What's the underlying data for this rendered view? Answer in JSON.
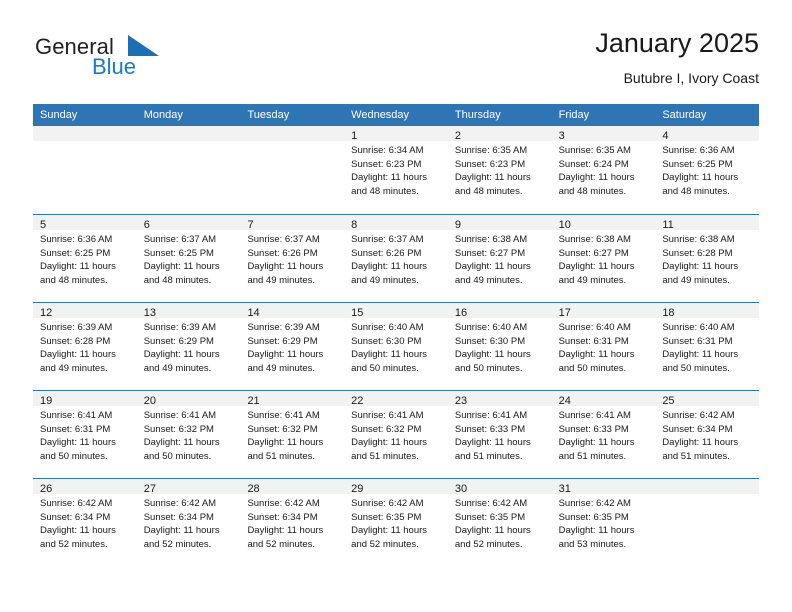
{
  "brand": {
    "name_part1": "General",
    "name_part2": "Blue",
    "logo_icon": "triangle-icon",
    "accent_color": "#1e7ac2"
  },
  "header": {
    "title": "January 2025",
    "subtitle": "Butubre I, Ivory Coast"
  },
  "theme": {
    "header_blue": "#2e75b6",
    "day_band_gray": "#f2f2f2",
    "text_color": "#1a1a1a"
  },
  "weekdays": [
    "Sunday",
    "Monday",
    "Tuesday",
    "Wednesday",
    "Thursday",
    "Friday",
    "Saturday"
  ],
  "weeks": [
    [
      {
        "day": "",
        "lines": []
      },
      {
        "day": "",
        "lines": []
      },
      {
        "day": "",
        "lines": []
      },
      {
        "day": "1",
        "lines": [
          "Sunrise: 6:34 AM",
          "Sunset: 6:23 PM",
          "Daylight: 11 hours",
          "and 48 minutes."
        ]
      },
      {
        "day": "2",
        "lines": [
          "Sunrise: 6:35 AM",
          "Sunset: 6:23 PM",
          "Daylight: 11 hours",
          "and 48 minutes."
        ]
      },
      {
        "day": "3",
        "lines": [
          "Sunrise: 6:35 AM",
          "Sunset: 6:24 PM",
          "Daylight: 11 hours",
          "and 48 minutes."
        ]
      },
      {
        "day": "4",
        "lines": [
          "Sunrise: 6:36 AM",
          "Sunset: 6:25 PM",
          "Daylight: 11 hours",
          "and 48 minutes."
        ]
      }
    ],
    [
      {
        "day": "5",
        "lines": [
          "Sunrise: 6:36 AM",
          "Sunset: 6:25 PM",
          "Daylight: 11 hours",
          "and 48 minutes."
        ]
      },
      {
        "day": "6",
        "lines": [
          "Sunrise: 6:37 AM",
          "Sunset: 6:25 PM",
          "Daylight: 11 hours",
          "and 48 minutes."
        ]
      },
      {
        "day": "7",
        "lines": [
          "Sunrise: 6:37 AM",
          "Sunset: 6:26 PM",
          "Daylight: 11 hours",
          "and 49 minutes."
        ]
      },
      {
        "day": "8",
        "lines": [
          "Sunrise: 6:37 AM",
          "Sunset: 6:26 PM",
          "Daylight: 11 hours",
          "and 49 minutes."
        ]
      },
      {
        "day": "9",
        "lines": [
          "Sunrise: 6:38 AM",
          "Sunset: 6:27 PM",
          "Daylight: 11 hours",
          "and 49 minutes."
        ]
      },
      {
        "day": "10",
        "lines": [
          "Sunrise: 6:38 AM",
          "Sunset: 6:27 PM",
          "Daylight: 11 hours",
          "and 49 minutes."
        ]
      },
      {
        "day": "11",
        "lines": [
          "Sunrise: 6:38 AM",
          "Sunset: 6:28 PM",
          "Daylight: 11 hours",
          "and 49 minutes."
        ]
      }
    ],
    [
      {
        "day": "12",
        "lines": [
          "Sunrise: 6:39 AM",
          "Sunset: 6:28 PM",
          "Daylight: 11 hours",
          "and 49 minutes."
        ]
      },
      {
        "day": "13",
        "lines": [
          "Sunrise: 6:39 AM",
          "Sunset: 6:29 PM",
          "Daylight: 11 hours",
          "and 49 minutes."
        ]
      },
      {
        "day": "14",
        "lines": [
          "Sunrise: 6:39 AM",
          "Sunset: 6:29 PM",
          "Daylight: 11 hours",
          "and 49 minutes."
        ]
      },
      {
        "day": "15",
        "lines": [
          "Sunrise: 6:40 AM",
          "Sunset: 6:30 PM",
          "Daylight: 11 hours",
          "and 50 minutes."
        ]
      },
      {
        "day": "16",
        "lines": [
          "Sunrise: 6:40 AM",
          "Sunset: 6:30 PM",
          "Daylight: 11 hours",
          "and 50 minutes."
        ]
      },
      {
        "day": "17",
        "lines": [
          "Sunrise: 6:40 AM",
          "Sunset: 6:31 PM",
          "Daylight: 11 hours",
          "and 50 minutes."
        ]
      },
      {
        "day": "18",
        "lines": [
          "Sunrise: 6:40 AM",
          "Sunset: 6:31 PM",
          "Daylight: 11 hours",
          "and 50 minutes."
        ]
      }
    ],
    [
      {
        "day": "19",
        "lines": [
          "Sunrise: 6:41 AM",
          "Sunset: 6:31 PM",
          "Daylight: 11 hours",
          "and 50 minutes."
        ]
      },
      {
        "day": "20",
        "lines": [
          "Sunrise: 6:41 AM",
          "Sunset: 6:32 PM",
          "Daylight: 11 hours",
          "and 50 minutes."
        ]
      },
      {
        "day": "21",
        "lines": [
          "Sunrise: 6:41 AM",
          "Sunset: 6:32 PM",
          "Daylight: 11 hours",
          "and 51 minutes."
        ]
      },
      {
        "day": "22",
        "lines": [
          "Sunrise: 6:41 AM",
          "Sunset: 6:32 PM",
          "Daylight: 11 hours",
          "and 51 minutes."
        ]
      },
      {
        "day": "23",
        "lines": [
          "Sunrise: 6:41 AM",
          "Sunset: 6:33 PM",
          "Daylight: 11 hours",
          "and 51 minutes."
        ]
      },
      {
        "day": "24",
        "lines": [
          "Sunrise: 6:41 AM",
          "Sunset: 6:33 PM",
          "Daylight: 11 hours",
          "and 51 minutes."
        ]
      },
      {
        "day": "25",
        "lines": [
          "Sunrise: 6:42 AM",
          "Sunset: 6:34 PM",
          "Daylight: 11 hours",
          "and 51 minutes."
        ]
      }
    ],
    [
      {
        "day": "26",
        "lines": [
          "Sunrise: 6:42 AM",
          "Sunset: 6:34 PM",
          "Daylight: 11 hours",
          "and 52 minutes."
        ]
      },
      {
        "day": "27",
        "lines": [
          "Sunrise: 6:42 AM",
          "Sunset: 6:34 PM",
          "Daylight: 11 hours",
          "and 52 minutes."
        ]
      },
      {
        "day": "28",
        "lines": [
          "Sunrise: 6:42 AM",
          "Sunset: 6:34 PM",
          "Daylight: 11 hours",
          "and 52 minutes."
        ]
      },
      {
        "day": "29",
        "lines": [
          "Sunrise: 6:42 AM",
          "Sunset: 6:35 PM",
          "Daylight: 11 hours",
          "and 52 minutes."
        ]
      },
      {
        "day": "30",
        "lines": [
          "Sunrise: 6:42 AM",
          "Sunset: 6:35 PM",
          "Daylight: 11 hours",
          "and 52 minutes."
        ]
      },
      {
        "day": "31",
        "lines": [
          "Sunrise: 6:42 AM",
          "Sunset: 6:35 PM",
          "Daylight: 11 hours",
          "and 53 minutes."
        ]
      },
      {
        "day": "",
        "lines": []
      }
    ]
  ]
}
